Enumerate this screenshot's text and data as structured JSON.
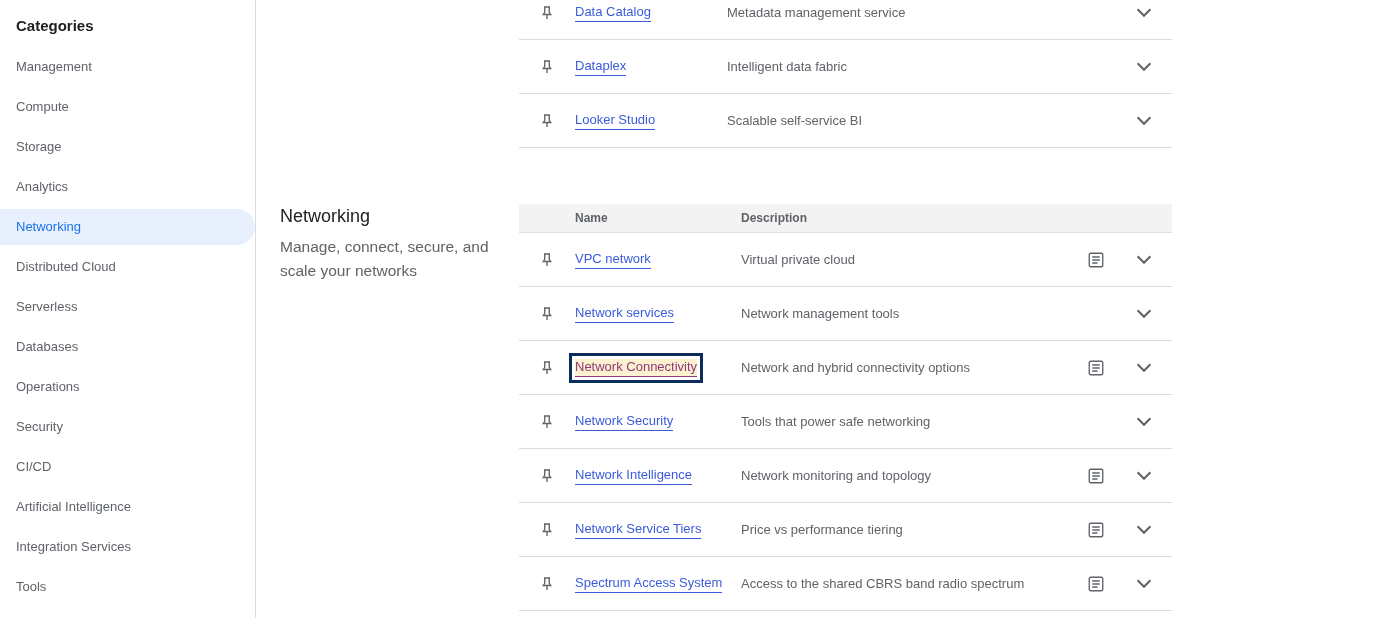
{
  "sidebar": {
    "title": "Categories",
    "items": [
      {
        "label": "Management",
        "selected": false
      },
      {
        "label": "Compute",
        "selected": false
      },
      {
        "label": "Storage",
        "selected": false
      },
      {
        "label": "Analytics",
        "selected": false
      },
      {
        "label": "Networking",
        "selected": true
      },
      {
        "label": "Distributed Cloud",
        "selected": false
      },
      {
        "label": "Serverless",
        "selected": false
      },
      {
        "label": "Databases",
        "selected": false
      },
      {
        "label": "Operations",
        "selected": false
      },
      {
        "label": "Security",
        "selected": false
      },
      {
        "label": "CI/CD",
        "selected": false
      },
      {
        "label": "Artificial Intelligence",
        "selected": false
      },
      {
        "label": "Integration Services",
        "selected": false
      },
      {
        "label": "Tools",
        "selected": false
      }
    ]
  },
  "sections": [
    {
      "rows": [
        {
          "name": "Data Catalog",
          "description": "Metadata management service",
          "has_docs": false,
          "focused": false
        },
        {
          "name": "Dataplex",
          "description": "Intelligent data fabric",
          "has_docs": false,
          "focused": false
        },
        {
          "name": "Looker Studio",
          "description": "Scalable self-service BI",
          "has_docs": false,
          "focused": false
        }
      ]
    },
    {
      "title": "Networking",
      "description": "Manage, connect, secure, and scale your networks",
      "columns": [
        "Name",
        "Description"
      ],
      "rows": [
        {
          "name": "VPC network",
          "description": "Virtual private cloud",
          "has_docs": true,
          "focused": false
        },
        {
          "name": "Network services",
          "description": "Network management tools",
          "has_docs": false,
          "focused": false
        },
        {
          "name": "Network Connectivity",
          "description": "Network and hybrid connectivity options",
          "has_docs": true,
          "focused": true
        },
        {
          "name": "Network Security",
          "description": "Tools that power safe networking",
          "has_docs": false,
          "focused": false
        },
        {
          "name": "Network Intelligence",
          "description": "Network monitoring and topology",
          "has_docs": true,
          "focused": false
        },
        {
          "name": "Network Service Tiers",
          "description": "Price vs performance tiering",
          "has_docs": true,
          "focused": false
        },
        {
          "name": "Spectrum Access System",
          "description": "Access to the shared CBRS band radio spectrum",
          "has_docs": true,
          "focused": false
        }
      ]
    }
  ]
}
